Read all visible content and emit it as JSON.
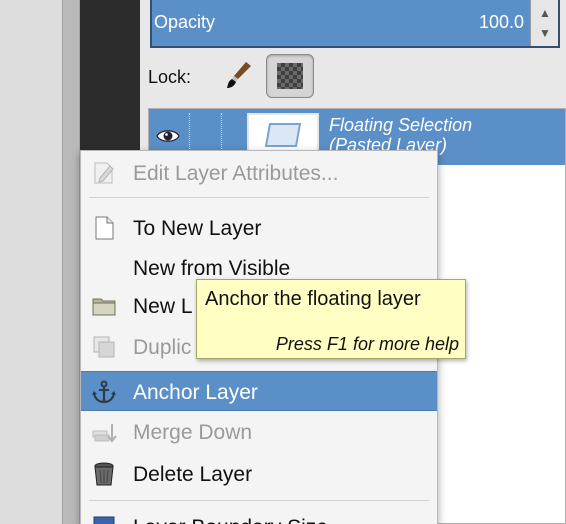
{
  "opacity": {
    "label": "Opacity",
    "value": "100.0",
    "up_glyph": "▲",
    "down_glyph": "▼"
  },
  "lock": {
    "label": "Lock:",
    "icons": [
      "paintbrush-icon",
      "checkerboard-alpha-icon"
    ]
  },
  "layer": {
    "name_line1": "Floating Selection",
    "name_line2": "(Pasted Layer)",
    "visible_icon": "eye-icon"
  },
  "menu": {
    "items": [
      {
        "label": "Edit Layer Attributes...",
        "icon": "pencil-doc-icon",
        "disabled": true
      },
      {
        "label": "To New Layer",
        "icon": "new-doc-icon",
        "disabled": false
      },
      {
        "label": "New from Visible",
        "icon": "",
        "disabled": false
      },
      {
        "label": "New L",
        "icon": "folder-icon",
        "disabled": false
      },
      {
        "label": "Duplic",
        "icon": "duplicate-icon",
        "disabled": true
      },
      {
        "label": "Anchor Layer",
        "icon": "anchor-icon",
        "disabled": false,
        "active": true
      },
      {
        "label": "Merge Down",
        "icon": "merge-down-icon",
        "disabled": true
      },
      {
        "label": "Delete Layer",
        "icon": "trash-icon",
        "disabled": false
      },
      {
        "label": "Layer Boundary Size",
        "icon": "boundary-icon",
        "disabled": false
      }
    ]
  },
  "tooltip": {
    "title": "Anchor the floating layer",
    "help": "Press F1 for more help"
  },
  "colors": {
    "selection": "#5b8fc7",
    "tooltip_bg": "#ffffc4"
  }
}
